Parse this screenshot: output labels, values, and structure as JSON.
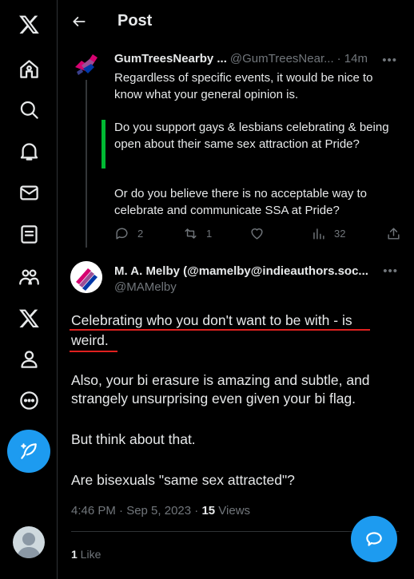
{
  "header": {
    "title": "Post"
  },
  "sidebar": {
    "items": [
      {
        "icon": "x-logo-icon"
      },
      {
        "icon": "home-icon"
      },
      {
        "icon": "search-icon"
      },
      {
        "icon": "notifications-icon"
      },
      {
        "icon": "messages-icon"
      },
      {
        "icon": "lists-icon"
      },
      {
        "icon": "communities-icon"
      },
      {
        "icon": "premium-icon"
      },
      {
        "icon": "profile-icon"
      },
      {
        "icon": "more-icon"
      }
    ],
    "compose_icon": "compose-post-icon"
  },
  "parent_tweet": {
    "name": "GumTreesNearby ...",
    "handle": "@GumTreesNear...",
    "time": "· 14m",
    "text1": "Regardless of specific events, it would be nice to know what your general opinion is.",
    "quote": "Do you support gays & lesbians celebrating & being open about their same sex attraction at Pride?",
    "text2": "Or do you believe there is no acceptable way to celebrate and communicate SSA at Pride?",
    "replies": "2",
    "reposts": "1",
    "likes": "",
    "views": "32"
  },
  "main_tweet": {
    "name": "M. A. Melby (@mamelby@indieauthors.soc...",
    "handle": "@MAMelby",
    "line1": "Celebrating who you don't want to be with - is",
    "line2": "weird.",
    "para2": "Also, your bi erasure is amazing and subtle, and strangely unsurprising even given your bi flag.",
    "para3": "But think about that.",
    "para4": "Are bisexuals \"same sex attracted\"?",
    "timestamp": "4:46 PM · Sep 5, 2023 · ",
    "views_count": "15",
    "views_label": " Views",
    "like_count": "1",
    "like_label": " Like"
  },
  "colors": {
    "accent": "#1d9bf0",
    "quote_bar": "#00ba33",
    "annotation": "#e0201f",
    "background": "#000000"
  }
}
